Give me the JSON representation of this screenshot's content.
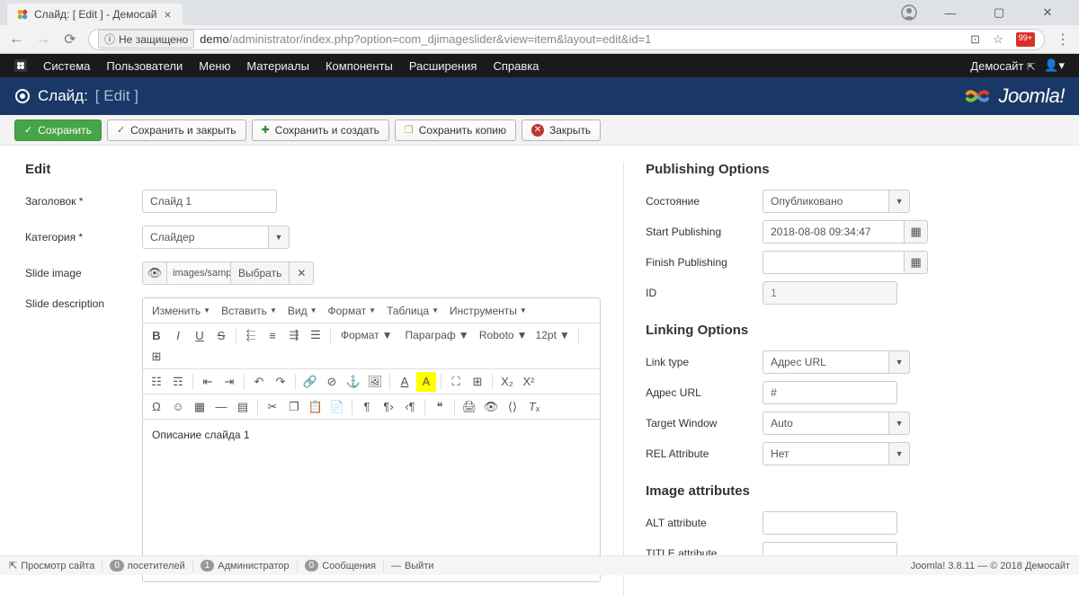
{
  "browser": {
    "tab_title": "Слайд: [ Edit ] - Демосай",
    "url_prefix": "Не защищено",
    "url_domain": "demo",
    "url_path": "/administrator/index.php?option=com_djimageslider&view=item&layout=edit&id=1",
    "ext_badge": "99+"
  },
  "admin_menu": {
    "items": [
      "Система",
      "Пользователи",
      "Меню",
      "Материалы",
      "Компоненты",
      "Расширения",
      "Справка"
    ],
    "site_name": "Демосайт"
  },
  "title": {
    "main": "Слайд:",
    "sub": "[ Edit ]",
    "brand": "Joomla!"
  },
  "toolbar": {
    "save": "Сохранить",
    "save_close": "Сохранить и закрыть",
    "save_new": "Сохранить и создать",
    "save_copy": "Сохранить копию",
    "close": "Закрыть"
  },
  "form": {
    "heading": "Edit",
    "labels": {
      "title": "Заголовок *",
      "category": "Категория *",
      "image": "Slide image",
      "description": "Slide description"
    },
    "title_value": "Слайд 1",
    "category_value": "Слайдер",
    "image_path": "images/samplei",
    "image_select": "Выбрать",
    "desc_value": "Описание слайда 1"
  },
  "editor": {
    "menus": [
      "Изменить",
      "Вставить",
      "Вид",
      "Формат",
      "Таблица",
      "Инструменты"
    ],
    "format_dd": "Формат",
    "paragraph_dd": "Параграф",
    "font_dd": "Roboto",
    "size_dd": "12pt"
  },
  "pub": {
    "heading": "Publishing Options",
    "labels": {
      "state": "Состояние",
      "start": "Start Publishing",
      "finish": "Finish Publishing",
      "id": "ID"
    },
    "state_value": "Опубликовано",
    "start_value": "2018-08-08 09:34:47",
    "finish_value": "",
    "id_value": "1"
  },
  "link": {
    "heading": "Linking Options",
    "labels": {
      "type": "Link type",
      "url": "Адрес URL",
      "target": "Target Window",
      "rel": "REL Attribute"
    },
    "type_value": "Адрес URL",
    "url_value": "#",
    "target_value": "Auto",
    "rel_value": "Нет"
  },
  "img_attr": {
    "heading": "Image attributes",
    "labels": {
      "alt": "ALT attribute",
      "title": "TITLE attribute"
    },
    "alt_value": "",
    "title_value": ""
  },
  "status": {
    "view_site": "Просмотр сайта",
    "visitors_count": "0",
    "visitors": "посетителей",
    "admins_count": "1",
    "admins": "Администратор",
    "msgs_count": "0",
    "msgs": "Сообщения",
    "logout": "Выйти",
    "version": "Joomla! 3.8.11",
    "copyright": "— © 2018 Демосайт"
  }
}
